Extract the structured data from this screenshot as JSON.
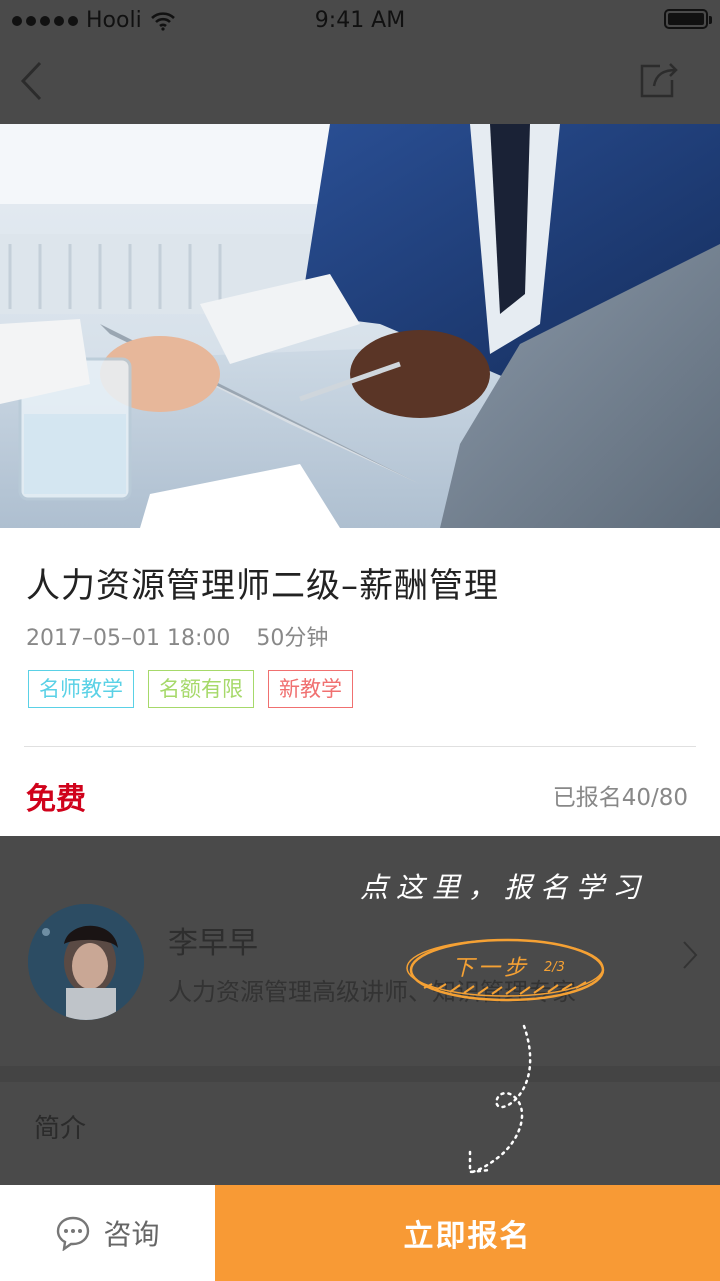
{
  "status_bar": {
    "carrier": "Hooli",
    "time": "9:41 AM",
    "battery_level": 1.0
  },
  "nav": {
    "back_icon": "chevron-left-icon",
    "share_icon": "share-icon"
  },
  "course": {
    "title": "人力资源管理师二级–薪酬管理",
    "datetime": "2017–05–01 18:00",
    "duration": "50分钟",
    "tags": [
      {
        "label": "名师教学",
        "color": "#5ad1e6"
      },
      {
        "label": "名额有限",
        "color": "#a6d96a"
      },
      {
        "label": "新教学",
        "color": "#f07070"
      }
    ],
    "price": "免费",
    "enrolled": "已报名40/80"
  },
  "teacher": {
    "name": "李早早",
    "description": "人力资源管理高级讲师、知识管理专家"
  },
  "intro": {
    "label": "简介"
  },
  "guide": {
    "hint": "点这里，报名学习",
    "next": "下一步",
    "step": "2/3"
  },
  "bottom_bar": {
    "consult_label": "咨询",
    "consult_icon": "chat-bubble-icon",
    "enroll_label": "立即报名"
  },
  "colors": {
    "accent": "#f89a35",
    "price": "#d0021b",
    "overlay": "#4a4a4a"
  }
}
